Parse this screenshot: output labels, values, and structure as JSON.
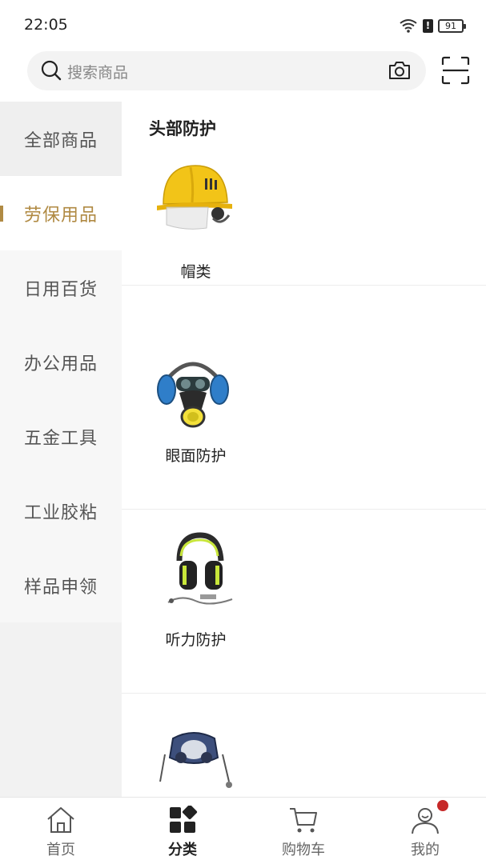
{
  "status_bar": {
    "time": "22:05",
    "battery_level": "91",
    "alert_glyph": "!"
  },
  "search": {
    "placeholder": "搜索商品"
  },
  "sidebar": {
    "items": [
      {
        "label": "全部商品"
      },
      {
        "label": "劳保用品"
      },
      {
        "label": "日用百货"
      },
      {
        "label": "办公用品"
      },
      {
        "label": "五金工具"
      },
      {
        "label": "工业胶粘"
      },
      {
        "label": "样品申领"
      }
    ],
    "active_index": 1
  },
  "content": {
    "section_title": "头部防护",
    "items": [
      {
        "label": "帽类",
        "icon": "safety-helmet-image"
      },
      {
        "label": "眼面防护",
        "icon": "respirator-mask-image"
      },
      {
        "label": "听力防护",
        "icon": "earmuff-image"
      },
      {
        "label": "",
        "icon": "half-mask-image"
      }
    ]
  },
  "tab_bar": {
    "tabs": [
      {
        "label": "首页",
        "icon": "home-icon"
      },
      {
        "label": "分类",
        "icon": "category-icon"
      },
      {
        "label": "购物车",
        "icon": "cart-icon"
      },
      {
        "label": "我的",
        "icon": "profile-icon"
      }
    ],
    "active_index": 1
  },
  "colors": {
    "accent": "#b08a43",
    "badge": "#c62828",
    "sidebar_bg": "#f2f2f2"
  }
}
